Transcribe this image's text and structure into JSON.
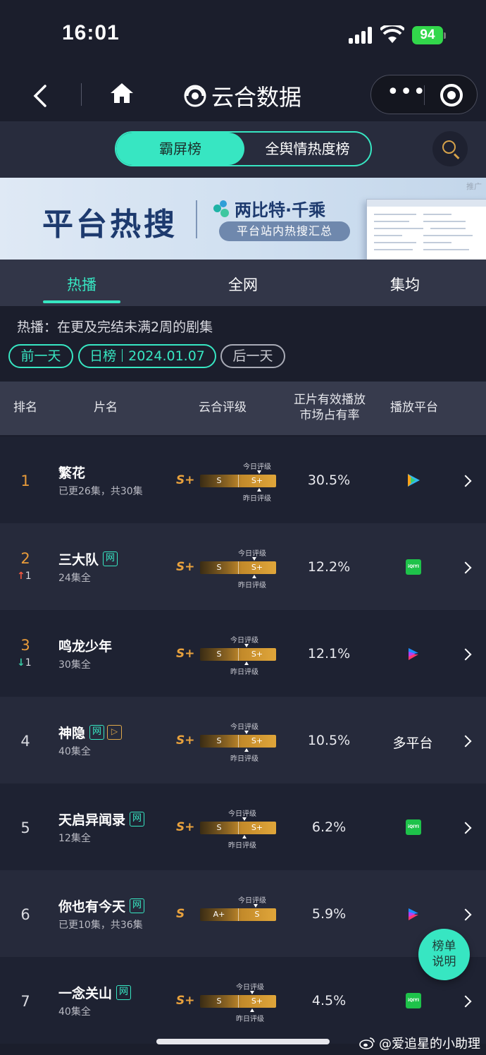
{
  "status": {
    "time": "16:01",
    "battery": "94"
  },
  "nav": {
    "brand": "云合数据"
  },
  "segments": {
    "active": "霸屏榜",
    "other": "全舆情热度榜"
  },
  "banner": {
    "ad": "推广",
    "big": "平台热搜",
    "brand": "两比特·千乘",
    "sub": "平台站内热搜汇总"
  },
  "tabs": [
    "热播",
    "全网",
    "集均"
  ],
  "desc": "热播：在更及完结未满2周的剧集",
  "dates": {
    "prev": "前一天",
    "board": "日榜",
    "date": "2024.01.07",
    "next": "后一天"
  },
  "table_header": {
    "rank": "排名",
    "title": "片名",
    "rating": "云合评级",
    "share_l1": "正片有效播放",
    "share_l2": "市场占有率",
    "platform": "播放平台"
  },
  "labels": {
    "today": "今日评级",
    "yesterday": "昨日评级"
  },
  "rows": [
    {
      "rank": "1",
      "change": "",
      "title": "繁花",
      "tags": [],
      "sub": "已更26集，共30集",
      "grade": "S+",
      "yest": "S",
      "today": "S+",
      "share": "30.5%",
      "platform": "tencent-video-icon"
    },
    {
      "rank": "2",
      "change": "1",
      "dir": "up",
      "title": "三大队",
      "tags": [
        "网"
      ],
      "sub": "24集全",
      "grade": "S+",
      "yest": "S",
      "today": "S+",
      "share": "12.2%",
      "platform": "iqiyi-icon"
    },
    {
      "rank": "3",
      "change": "1",
      "dir": "down",
      "title": "鸣龙少年",
      "tags": [],
      "sub": "30集全",
      "grade": "S+",
      "yest": "S",
      "today": "S+",
      "share": "12.1%",
      "platform": "youku-icon"
    },
    {
      "rank": "4",
      "change": "",
      "title": "神隐",
      "tags": [
        "网",
        "▷"
      ],
      "sub": "40集全",
      "grade": "S+",
      "yest": "S",
      "today": "S+",
      "share": "10.5%",
      "platform": "多平台"
    },
    {
      "rank": "5",
      "change": "",
      "title": "天启异闻录",
      "tags": [
        "网"
      ],
      "sub": "12集全",
      "grade": "S+",
      "yest": "S",
      "today": "S+",
      "share": "6.2%",
      "platform": "iqiyi-icon"
    },
    {
      "rank": "6",
      "change": "",
      "title": "你也有今天",
      "tags": [
        "网"
      ],
      "sub": "已更10集，共36集",
      "grade": "S",
      "yest": "A+",
      "today": "S",
      "share": "5.9%",
      "platform": "youku-icon"
    },
    {
      "rank": "7",
      "change": "",
      "title": "一念关山",
      "tags": [
        "网"
      ],
      "sub": "40集全",
      "grade": "S+",
      "yest": "S",
      "today": "S+",
      "share": "4.5%",
      "platform": "iqiyi-icon"
    }
  ],
  "float_button": {
    "l1": "榜单",
    "l2": "说明"
  },
  "watermark": "@爱追星的小助理",
  "iqiyi_text": "iQIYI",
  "colors": {
    "accent": "#37e6c2",
    "gold": "#e9a23d",
    "background": "#1b1e2c"
  }
}
